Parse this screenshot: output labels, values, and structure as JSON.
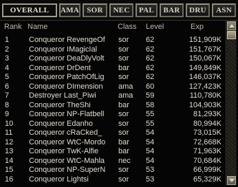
{
  "tabs": [
    {
      "label": "OVERALL",
      "active": true
    },
    {
      "label": "AMA",
      "active": false
    },
    {
      "label": "SOR",
      "active": false
    },
    {
      "label": "NEC",
      "active": false
    },
    {
      "label": "PAL",
      "active": false
    },
    {
      "label": "BAR",
      "active": false
    },
    {
      "label": "DRU",
      "active": false
    },
    {
      "label": "ASN",
      "active": false
    }
  ],
  "headers": {
    "rank": "Rank",
    "name": "Name",
    "class": "Class",
    "level": "Level",
    "exp": "Exp"
  },
  "rows": [
    {
      "rank": "1",
      "name": "Conqueror RevengeOf",
      "class": "sor",
      "level": "62",
      "exp": "151,909K"
    },
    {
      "rank": "2",
      "name": "Conqueror IMagicIal",
      "class": "sor",
      "level": "62",
      "exp": "151,767K"
    },
    {
      "rank": "3",
      "name": "Conqueror DeaDlyVolt",
      "class": "sor",
      "level": "62",
      "exp": "150,067K"
    },
    {
      "rank": "4",
      "name": "Conqueror DrDent",
      "class": "bar",
      "level": "62",
      "exp": "149,849K"
    },
    {
      "rank": "5",
      "name": "Conqueror PatchOfLig",
      "class": "sor",
      "level": "62",
      "exp": "146,037K"
    },
    {
      "rank": "6",
      "name": "Conqueror DImension",
      "class": "ama",
      "level": "60",
      "exp": "127,423K"
    },
    {
      "rank": "7",
      "name": "Destroyer Last_Piwi",
      "class": "ama",
      "level": "59",
      "exp": "110,780K"
    },
    {
      "rank": "8",
      "name": "Conqueror TheShi",
      "class": "bar",
      "level": "58",
      "exp": "104,903K"
    },
    {
      "rank": "9",
      "name": "Conqueror NP-Flatbell",
      "class": "sor",
      "level": "55",
      "exp": "81,293K"
    },
    {
      "rank": "10",
      "name": "Conqueror Edanho",
      "class": "sor",
      "level": "55",
      "exp": "80,994K"
    },
    {
      "rank": "11",
      "name": "Conqueror cRaCked_",
      "class": "sor",
      "level": "54",
      "exp": "73,015K"
    },
    {
      "rank": "12",
      "name": "Conqueror WtC-Mordo",
      "class": "bar",
      "level": "54",
      "exp": "72,668K"
    },
    {
      "rank": "13",
      "name": "Conqueror TwK-Alfie",
      "class": "bar",
      "level": "54",
      "exp": "71,963K"
    },
    {
      "rank": "14",
      "name": "Conqueror WtC-Mahla",
      "class": "nec",
      "level": "54",
      "exp": "70,684K"
    },
    {
      "rank": "15",
      "name": "Conqueror NP-SuperN",
      "class": "sor",
      "level": "53",
      "exp": "66,999K"
    },
    {
      "rank": "16",
      "name": "Conqueror Lightsi",
      "class": "sor",
      "level": "53",
      "exp": "65,329K"
    }
  ]
}
